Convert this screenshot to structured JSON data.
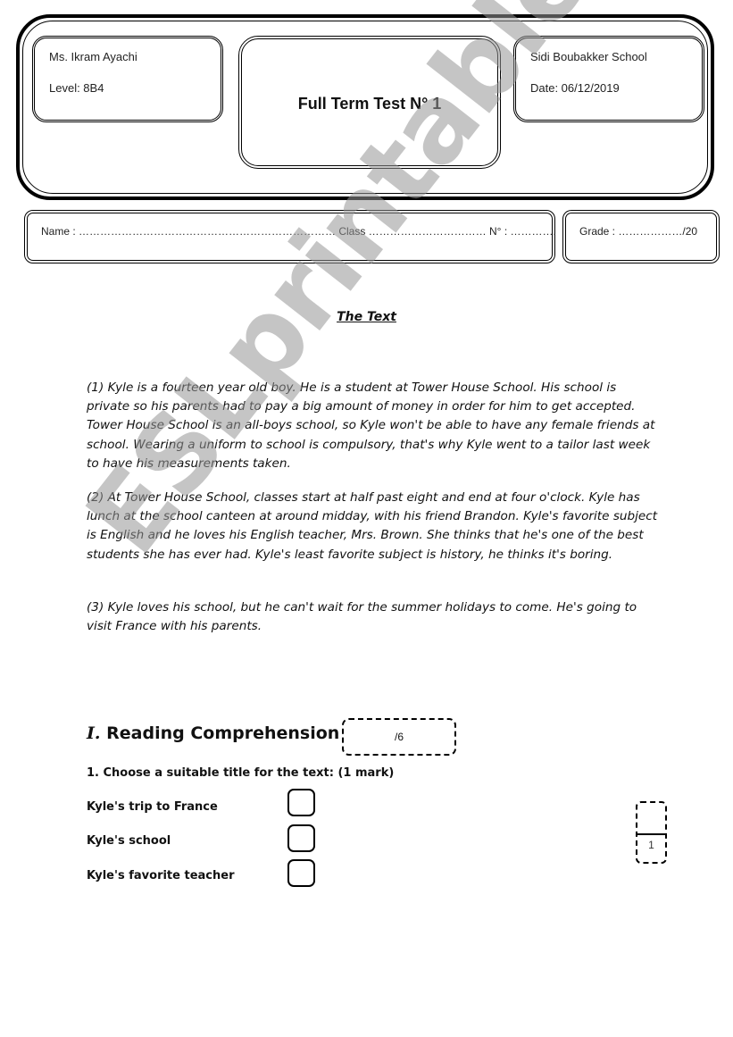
{
  "header": {
    "teacher": "Ms. Ikram Ayachi",
    "level": "Level: 8B4",
    "title": "Full Term Test N° 1",
    "school": "Sidi Boubakker School",
    "date": "Date: 06/12/2019"
  },
  "student_row": {
    "name_field": "Name : ……………………………………………………………… Class …………………………… N° : ………….",
    "grade_field": "Grade : ………………/20"
  },
  "text_section": {
    "title": "The Text",
    "paragraphs": [
      "(1) Kyle is a fourteen year old boy. He is a student at Tower House School. His school is private so his parents had to pay a big amount of money in order for him to get accepted. Tower House School is an all-boys school, so Kyle won't be able to have any female friends at school. Wearing a uniform to school is compulsory, that's why Kyle went to a tailor last week to have his measurements taken.",
      "(2) At Tower House School, classes start at half past eight and end at four o'clock. Kyle has lunch at the school canteen at around midday, with his friend Brandon. Kyle's favorite subject is English and he loves his English teacher, Mrs. Brown. She thinks that he's one of the best students she has ever had. Kyle's least favorite subject is history, he thinks it's boring.",
      "(3) Kyle loves his school, but he can't wait for the summer holidays to come. He's going to visit France with his parents."
    ]
  },
  "reading_comprehension": {
    "number": "I.",
    "title": "Reading Comprehension",
    "score": "/6",
    "question_1": {
      "prompt": "1. Choose a suitable title for the text: (1 mark)",
      "options": [
        "Kyle's trip to France",
        "Kyle's school",
        "Kyle's favorite teacher"
      ],
      "mark": "1"
    }
  },
  "watermark": "ESLprintables.com"
}
